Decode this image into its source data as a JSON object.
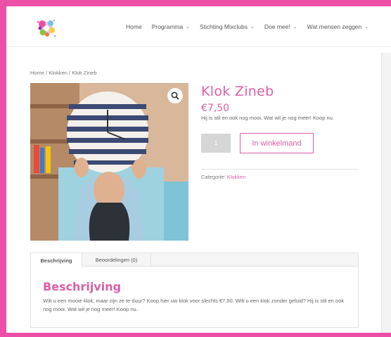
{
  "nav": {
    "items": [
      {
        "label": "Home",
        "dropdown": false
      },
      {
        "label": "Programma",
        "dropdown": true
      },
      {
        "label": "Stichting Mixclubs",
        "dropdown": true
      },
      {
        "label": "Doe mee!",
        "dropdown": true
      },
      {
        "label": "Wat mensen zeggen",
        "dropdown": true
      }
    ],
    "chevron": "⌄"
  },
  "breadcrumb": "Home / Klokken / Klok Zineb",
  "product": {
    "title": "Klok Zineb",
    "price": "€7,50",
    "short_description": "Hij is stil en ook nog mooi. Wat wil je nog meer! Koop nu.",
    "quantity": "1",
    "add_to_cart": "In winkelmand",
    "category_label": "Categorie: ",
    "category_link": "Klokken"
  },
  "tabs": {
    "items": [
      "Beschrijving",
      "Beoordelingen (0)"
    ],
    "active_heading": "Beschrijving",
    "body": "Wilt u een mooie klok, maar zijn ze te duur? Koop hier uw klok voor slechts €7,50. Wilt u een klok zonder geluid? Hij is stil en ook nog mooi. Wat wil je nog meer! Koop nu."
  },
  "colors": {
    "accent": "#d95fa6",
    "frame": "#ec4fa6"
  },
  "icons": {
    "zoom": "magnifier-icon",
    "logo": "colorful-splash-logo"
  }
}
